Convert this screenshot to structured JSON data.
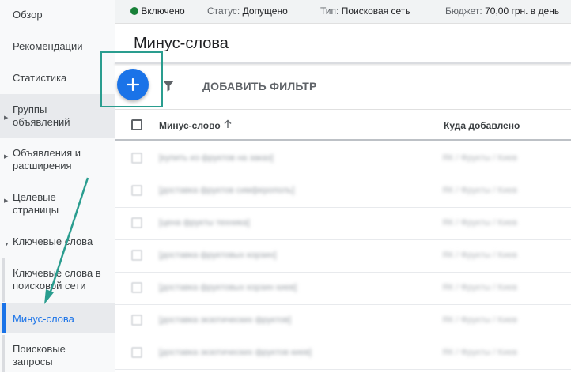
{
  "sidebar": {
    "items": [
      {
        "label": "Обзор"
      },
      {
        "label": "Рекомендации"
      },
      {
        "label": "Статистика"
      },
      {
        "label": "Группы объявлений"
      },
      {
        "label": "Объявления и расширения"
      },
      {
        "label": "Целевые страницы"
      },
      {
        "label": "Ключевые слова"
      },
      {
        "label": "Ключевые слова в поисковой сети"
      },
      {
        "label": "Минус-слова"
      },
      {
        "label": "Поисковые запросы"
      }
    ],
    "active_item": "Минус-слова"
  },
  "status_bar": {
    "enabled_label": "Включено",
    "status_key": "Статус:",
    "status_value": "Допущено",
    "type_key": "Тип:",
    "type_value": "Поисковая сеть",
    "budget_key": "Бюджет:",
    "budget_value": "70,00 грн. в день"
  },
  "page": {
    "title": "Минус-слова"
  },
  "toolbar": {
    "add_icon": "plus-icon",
    "filter_icon": "funnel-icon",
    "add_filter_label": "ДОБАВИТЬ ФИЛЬТР"
  },
  "table": {
    "columns": [
      "Минус-слово",
      "Куда добавлено"
    ],
    "sort_icon": "arrow-up-icon",
    "rows": [
      {
        "keyword": "[купить из фруктов на заказ]",
        "added_to": "ЯК / Фрукты / Киев"
      },
      {
        "keyword": "[доставка фруктов симферополь]",
        "added_to": "ЯК / Фрукты / Киев"
      },
      {
        "keyword": "[цена фрукты техника]",
        "added_to": "ЯК / Фрукты / Киев"
      },
      {
        "keyword": "[доставка фруктовых корзин]",
        "added_to": "ЯК / Фрукты / Киев"
      },
      {
        "keyword": "[доставка фруктовых корзин киев]",
        "added_to": "ЯК / Фрукты / Киев"
      },
      {
        "keyword": "[доставка экзотических фруктов]",
        "added_to": "ЯК / Фрукты / Киев"
      },
      {
        "keyword": "[доставка экзотических фруктов киев]",
        "added_to": "ЯК / Фрукты / Киев"
      }
    ]
  },
  "colors": {
    "accent": "#1a73e8",
    "annotation": "#2a9d8f",
    "enabled_dot": "#188038"
  }
}
